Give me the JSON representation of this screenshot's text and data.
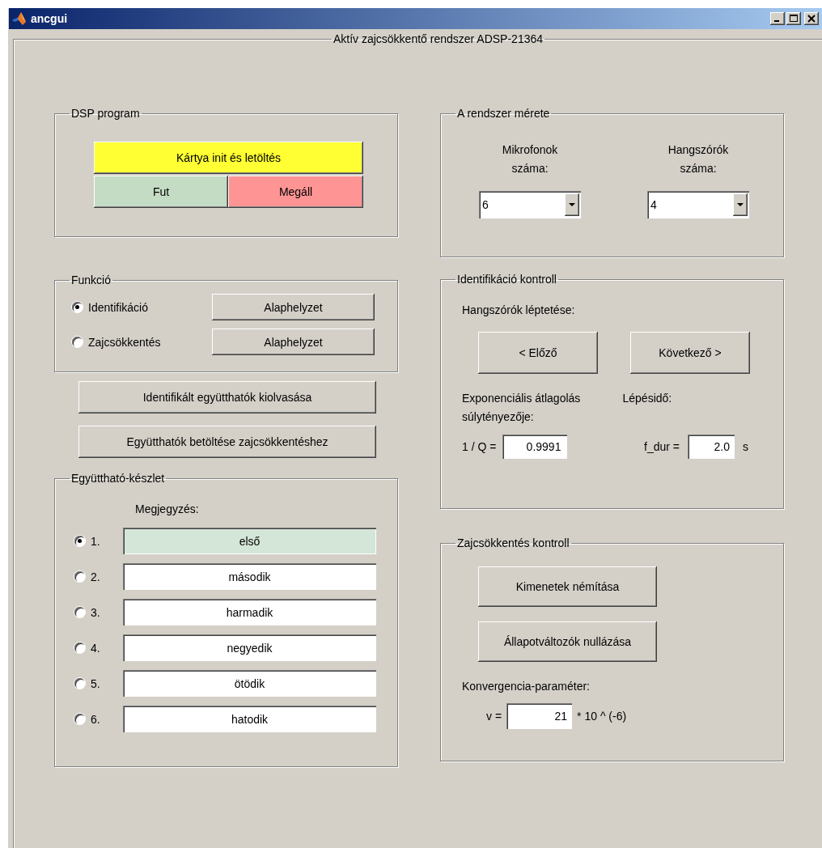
{
  "window": {
    "title": "ancgui"
  },
  "frame": {
    "title": "Aktív zajcsökkentő rendszer ADSP-21364"
  },
  "dsp_program": {
    "title": "DSP program",
    "buttons": [
      {
        "label": "Kártya init és letöltés",
        "color": "#ffff33"
      },
      {
        "label": "Fut",
        "color": "#c4dcc4"
      },
      {
        "label": "Megáll",
        "color": "#ff9494"
      }
    ]
  },
  "function": {
    "title": "Funkció",
    "options": [
      {
        "label": "Identifikáció",
        "selected": true,
        "reset_button": "Alaphelyzet"
      },
      {
        "label": "Zajcsökkentés",
        "selected": false,
        "reset_button": "Alaphelyzet"
      }
    ]
  },
  "action_buttons": [
    "Identifikált együtthatók kiolvasása",
    "Együtthatók betöltése zajcsökkentéshez"
  ],
  "coefficient_set": {
    "title": "Együttható-készlet",
    "note_label": "Megjegyzés:",
    "rows": [
      {
        "number": "1.",
        "note": "első",
        "selected": true
      },
      {
        "number": "2.",
        "note": "második",
        "selected": false
      },
      {
        "number": "3.",
        "note": "harmadik",
        "selected": false
      },
      {
        "number": "4.",
        "note": "negyedik",
        "selected": false
      },
      {
        "number": "5.",
        "note": "ötödik",
        "selected": false
      },
      {
        "number": "6.",
        "note": "hatodik",
        "selected": false
      }
    ]
  },
  "system_size": {
    "title": "A rendszer mérete",
    "selects": [
      {
        "label": "Mikrofonok száma:",
        "value": "6"
      },
      {
        "label": "Hangszórók száma:",
        "value": "4"
      }
    ]
  },
  "identification_control": {
    "title": "Identifikáció kontroll",
    "stepping_label": "Hangszórók léptetése:",
    "buttons": [
      "< Előző",
      "Következő >"
    ],
    "averaging_label": "Exponenciális átlagolás súlytényezője:",
    "step_label": "Lépésidő:",
    "q_label": "1 / Q =",
    "q_value": "0.9991",
    "dur_label": "f_dur =",
    "dur_value": "2.0",
    "dur_unit": "s"
  },
  "noise_control": {
    "title": "Zajcsökkentés kontroll",
    "buttons": [
      "Kimenetek némítása",
      "Állapotváltozók nullázása"
    ],
    "convergence_label": "Konvergencia-paraméter:",
    "v_label": "v =",
    "v_value": "21",
    "v_suffix": "* 10 ^ (-6)"
  }
}
